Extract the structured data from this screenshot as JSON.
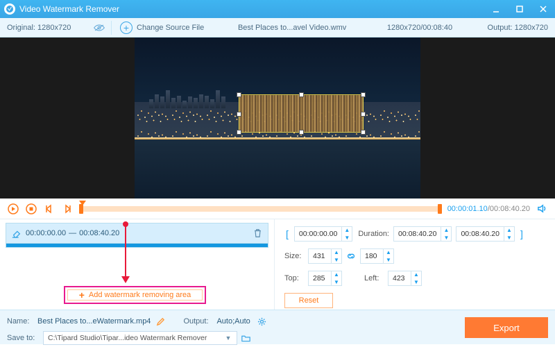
{
  "titlebar": {
    "app_name": "Video Watermark Remover"
  },
  "subbar": {
    "original_label": "Original:  1280x720",
    "change_source_label": "Change Source File",
    "filename": "Best Places to...avel Video.wmv",
    "dims_duration": "1280x720/00:08:40",
    "output_label": "Output:  1280x720"
  },
  "playback": {
    "current_time": "00:00:01.10",
    "total_time": "00:08:40.20"
  },
  "clip": {
    "start": "00:00:00.00",
    "end": "00:08:40.20"
  },
  "params": {
    "time_start": "00:00:00.00",
    "duration_label": "Duration:",
    "duration_value": "00:08:40.20",
    "time_end": "00:08:40.20",
    "size_label": "Size:",
    "size_w": "431",
    "size_h": "180",
    "top_label": "Top:",
    "top_value": "285",
    "left_label": "Left:",
    "left_value": "423",
    "reset_label": "Reset"
  },
  "add_area_label": "Add watermark removing area",
  "bottom": {
    "name_label": "Name:",
    "name_value": "Best Places to...eWatermark.mp4",
    "output_label": "Output:",
    "output_value": "Auto;Auto",
    "saveto_label": "Save to:",
    "saveto_value": "C:\\Tipard Studio\\Tipar...ideo Watermark Remover",
    "export_label": "Export"
  }
}
